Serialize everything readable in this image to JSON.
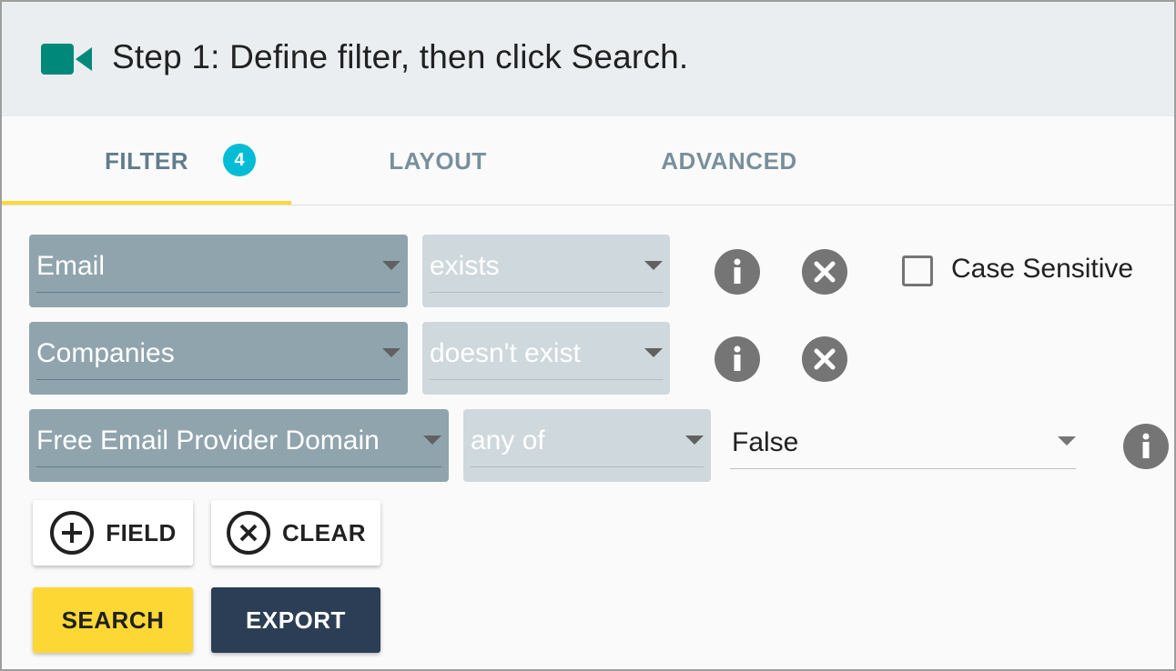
{
  "header": {
    "icon": "video-camera-icon",
    "title": "Step 1: Define filter, then click Search.",
    "accent_color": "#00897b"
  },
  "tabs": [
    {
      "label": "FILTER",
      "badge": "4",
      "active": true
    },
    {
      "label": "LAYOUT",
      "active": false
    },
    {
      "label": "ADVANCED",
      "active": false
    }
  ],
  "filters": [
    {
      "field": "Email",
      "operator": "exists"
    },
    {
      "field": "Companies",
      "operator": "doesn't exist"
    },
    {
      "field": "Free Email Provider Domain",
      "operator": "any of",
      "value": "False"
    }
  ],
  "case_sensitive": {
    "label": "Case Sensitive",
    "checked": false
  },
  "buttons": {
    "add_field": "FIELD",
    "clear": "CLEAR",
    "search": "SEARCH",
    "export": "EXPORT"
  },
  "colors": {
    "tab_underline": "#fdd835",
    "badge": "#00bcd4",
    "search_button": "#fdd835",
    "export_button": "#2c3e55"
  }
}
